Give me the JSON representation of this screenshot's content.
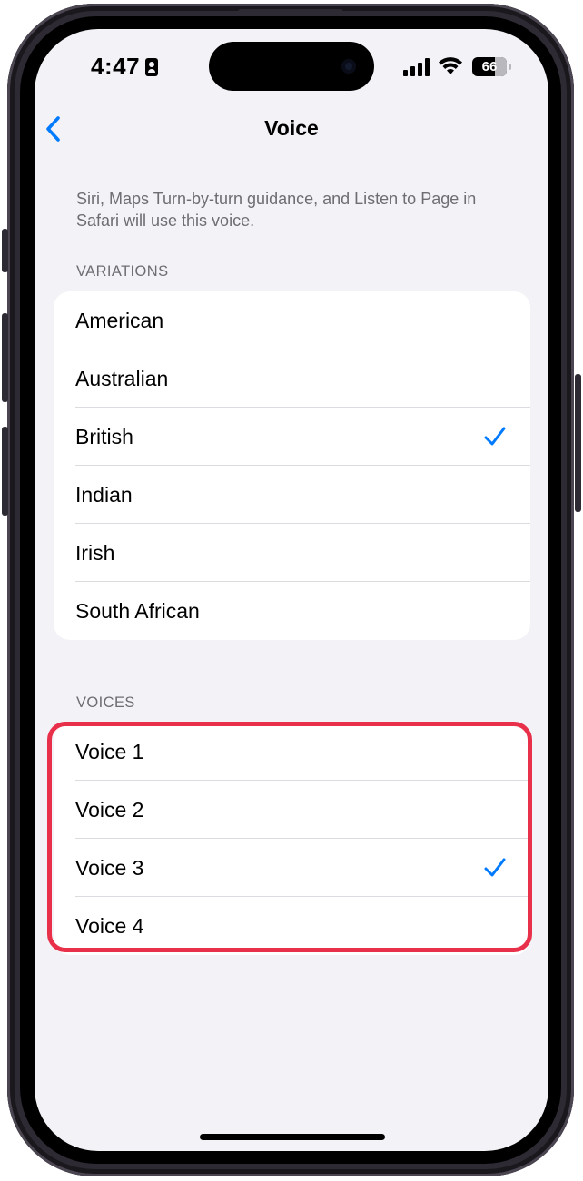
{
  "status_bar": {
    "time": "4:47",
    "battery_level": "66",
    "icons": [
      "id-card-icon",
      "signal-icon",
      "wifi-icon",
      "battery-icon"
    ]
  },
  "nav": {
    "title": "Voice",
    "back_icon": "chevron-left-icon"
  },
  "description": "Siri, Maps Turn-by-turn guidance, and Listen to Page in Safari will use this voice.",
  "variations": {
    "header": "VARIATIONS",
    "items": [
      {
        "label": "American",
        "selected": false
      },
      {
        "label": "Australian",
        "selected": false
      },
      {
        "label": "British",
        "selected": true
      },
      {
        "label": "Indian",
        "selected": false
      },
      {
        "label": "Irish",
        "selected": false
      },
      {
        "label": "South African",
        "selected": false
      }
    ]
  },
  "voices": {
    "header": "VOICES",
    "items": [
      {
        "label": "Voice 1",
        "selected": false
      },
      {
        "label": "Voice 2",
        "selected": false
      },
      {
        "label": "Voice 3",
        "selected": true
      },
      {
        "label": "Voice 4",
        "selected": false
      }
    ]
  },
  "colors": {
    "accent": "#007aff",
    "background": "#f2f2f7",
    "highlight": "#e8304a",
    "secondary_text": "#6d6d72"
  }
}
